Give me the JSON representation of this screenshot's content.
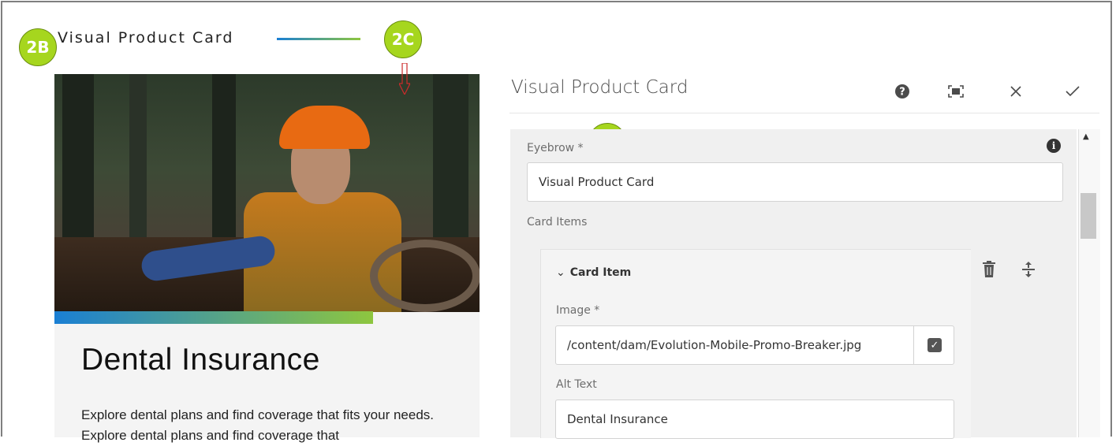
{
  "preview": {
    "eyebrow": "Visual Product Card",
    "card_title": "Dental Insurance",
    "card_description": "Explore dental plans and find coverage that fits your needs. Explore dental plans and find coverage that"
  },
  "callouts": [
    "2B",
    "2C",
    "2B",
    "2C"
  ],
  "dialog": {
    "title": "Visual Product Card",
    "toolbar": {
      "help_icon": "help-icon",
      "fullscreen_icon": "fullscreen-icon",
      "close_icon": "close-icon",
      "done_icon": "check-icon"
    },
    "eyebrow_label": "Eyebrow *",
    "eyebrow_value": "Visual Product Card",
    "card_items_label": "Card Items",
    "card_item": {
      "header": "Card Item",
      "image_label": "Image *",
      "image_value": "/content/dam/Evolution-Mobile-Promo-Breaker.jpg",
      "alt_label": "Alt Text",
      "alt_value": "Dental Insurance"
    }
  },
  "colors": {
    "callout": "#a6d61e",
    "accent_start": "#1a7fd4",
    "accent_end": "#8ec63f",
    "arrow": "#cc2b2b"
  }
}
